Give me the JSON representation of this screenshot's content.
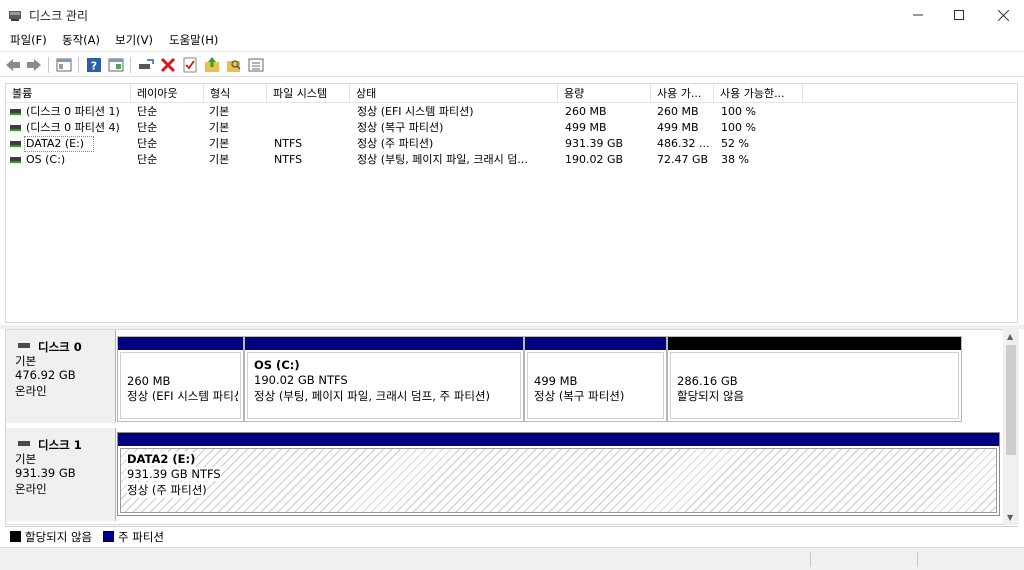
{
  "window": {
    "title": "디스크 관리",
    "min_icon": "minimize-icon",
    "max_icon": "maximize-icon",
    "close_icon": "close-icon"
  },
  "menu": [
    {
      "label": "파일(F)"
    },
    {
      "label": "동작(A)"
    },
    {
      "label": "보기(V)"
    },
    {
      "label": "도움말(H)"
    }
  ],
  "toolbar": [
    "back-arrow-icon",
    "forward-arrow-icon",
    "properties-view-icon",
    "help-icon",
    "console-view-icon",
    "rescan-disks-icon",
    "delete-icon",
    "check-icon",
    "up-folder-icon",
    "search-folder-icon",
    "list-view-icon"
  ],
  "volume_list": {
    "columns": [
      "볼륨",
      "레이아웃",
      "형식",
      "파일 시스템",
      "상태",
      "용량",
      "사용 가...",
      "사용 가능한..."
    ],
    "rows": [
      {
        "volume": "(디스크 0 파티션 1)",
        "layout": "단순",
        "type": "기본",
        "fs": "",
        "status": "정상 (EFI 시스템 파티션)",
        "capacity": "260 MB",
        "free": "260 MB",
        "pct_free": "100 %"
      },
      {
        "volume": "(디스크 0 파티션 4)",
        "layout": "단순",
        "type": "기본",
        "fs": "",
        "status": "정상 (복구 파티션)",
        "capacity": "499 MB",
        "free": "499 MB",
        "pct_free": "100 %"
      },
      {
        "volume": "DATA2 (E:)",
        "layout": "단순",
        "type": "기본",
        "fs": "NTFS",
        "status": "정상 (주 파티션)",
        "capacity": "931.39 GB",
        "free": "486.32 ...",
        "pct_free": "52 %"
      },
      {
        "volume": "OS (C:)",
        "layout": "단순",
        "type": "기본",
        "fs": "NTFS",
        "status": "정상 (부팅, 페이지 파일, 크래시 덤...",
        "capacity": "190.02 GB",
        "free": "72.47 GB",
        "pct_free": "38 %"
      }
    ]
  },
  "disks": [
    {
      "title": "디스크 0",
      "type": "기본",
      "size": "476.92 GB",
      "state": "온라인",
      "partitions": [
        {
          "name": "",
          "size": "260 MB",
          "status": "정상 (EFI 시스템 파티션)"
        },
        {
          "name": "OS  (C:)",
          "size": "190.02 GB NTFS",
          "status": "정상 (부팅, 페이지 파일, 크래시 덤프, 주 파티션)"
        },
        {
          "name": "",
          "size": "499 MB",
          "status": "정상 (복구 파티션)"
        },
        {
          "name": "",
          "size": "286.16 GB",
          "status": "할당되지 않음"
        }
      ]
    },
    {
      "title": "디스크 1",
      "type": "기본",
      "size": "931.39 GB",
      "state": "온라인",
      "partitions": [
        {
          "name": "DATA2  (E:)",
          "size": "931.39 GB NTFS",
          "status": "정상 (주 파티션)"
        }
      ]
    }
  ],
  "legend": [
    {
      "label": "할당되지 않음",
      "color": "#000000"
    },
    {
      "label": "주 파티션",
      "color": "#00008b"
    }
  ],
  "colors": {
    "primary_partition": "#000080",
    "unallocated": "#000000",
    "volume_green": "#2e9e2e"
  }
}
